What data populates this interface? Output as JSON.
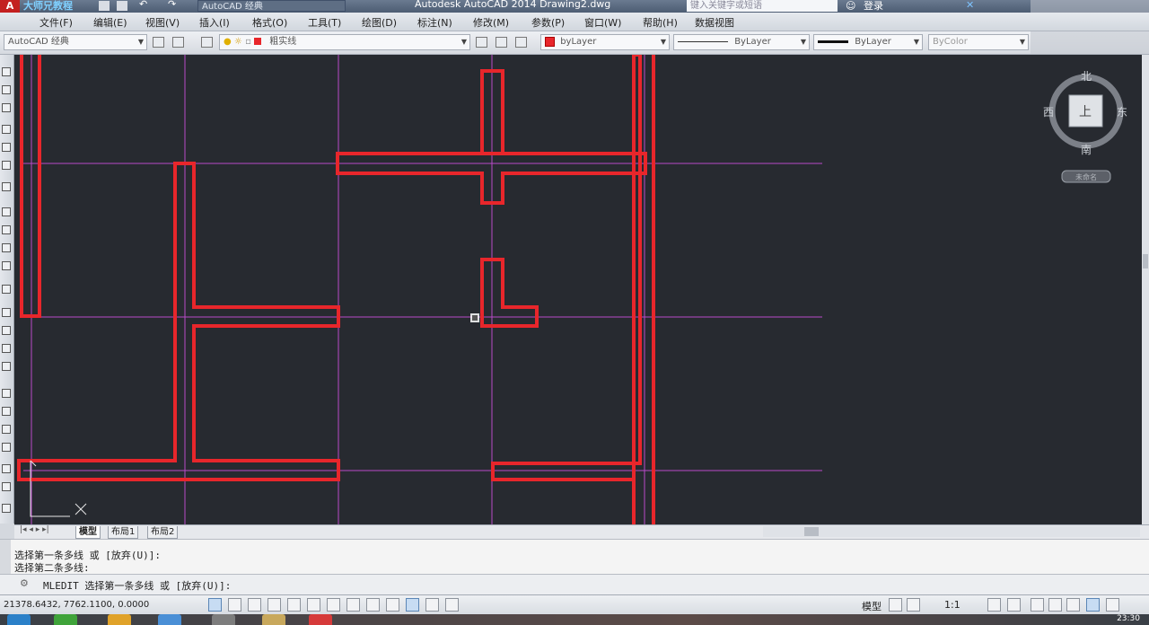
{
  "window": {
    "title": "Autodesk AutoCAD 2014    Drawing2.dwg",
    "logo_letter": "A",
    "watermark": "大师兄教程",
    "workspace_top": "AutoCAD 经典",
    "search_placeholder": "键入关键字或短语",
    "login": "登录"
  },
  "menubar": [
    "文件(F)",
    "编辑(E)",
    "视图(V)",
    "插入(I)",
    "格式(O)",
    "工具(T)",
    "绘图(D)",
    "标注(N)",
    "修改(M)",
    "参数(P)",
    "窗口(W)",
    "帮助(H)",
    "数据视图"
  ],
  "toolbar": {
    "workspace": "AutoCAD 经典",
    "layer": "粗实线",
    "color": "byLayer",
    "linetype": "ByLayer",
    "lineweight": "ByLayer",
    "plotstyle": "ByColor"
  },
  "viewcube": {
    "north": "北",
    "south": "南",
    "east": "东",
    "west": "西",
    "top": "上",
    "wcs": "未命名"
  },
  "tabs": [
    "模型",
    "布局1",
    "布局2"
  ],
  "command": {
    "history": [
      "选择第一条多线 或 [放弃(U)]:",
      "选择第二条多线:"
    ],
    "prompt": "MLEDIT 选择第一条多线 或 [放弃(U)]:"
  },
  "status": {
    "coords": "21378.6432, 7762.1100, 0.0000",
    "model": "模型",
    "scale": "1:1",
    "time": "23:30"
  },
  "colors": {
    "wall": "#e8262b",
    "axis": "#b84ac9",
    "canvas": "#272a30"
  }
}
